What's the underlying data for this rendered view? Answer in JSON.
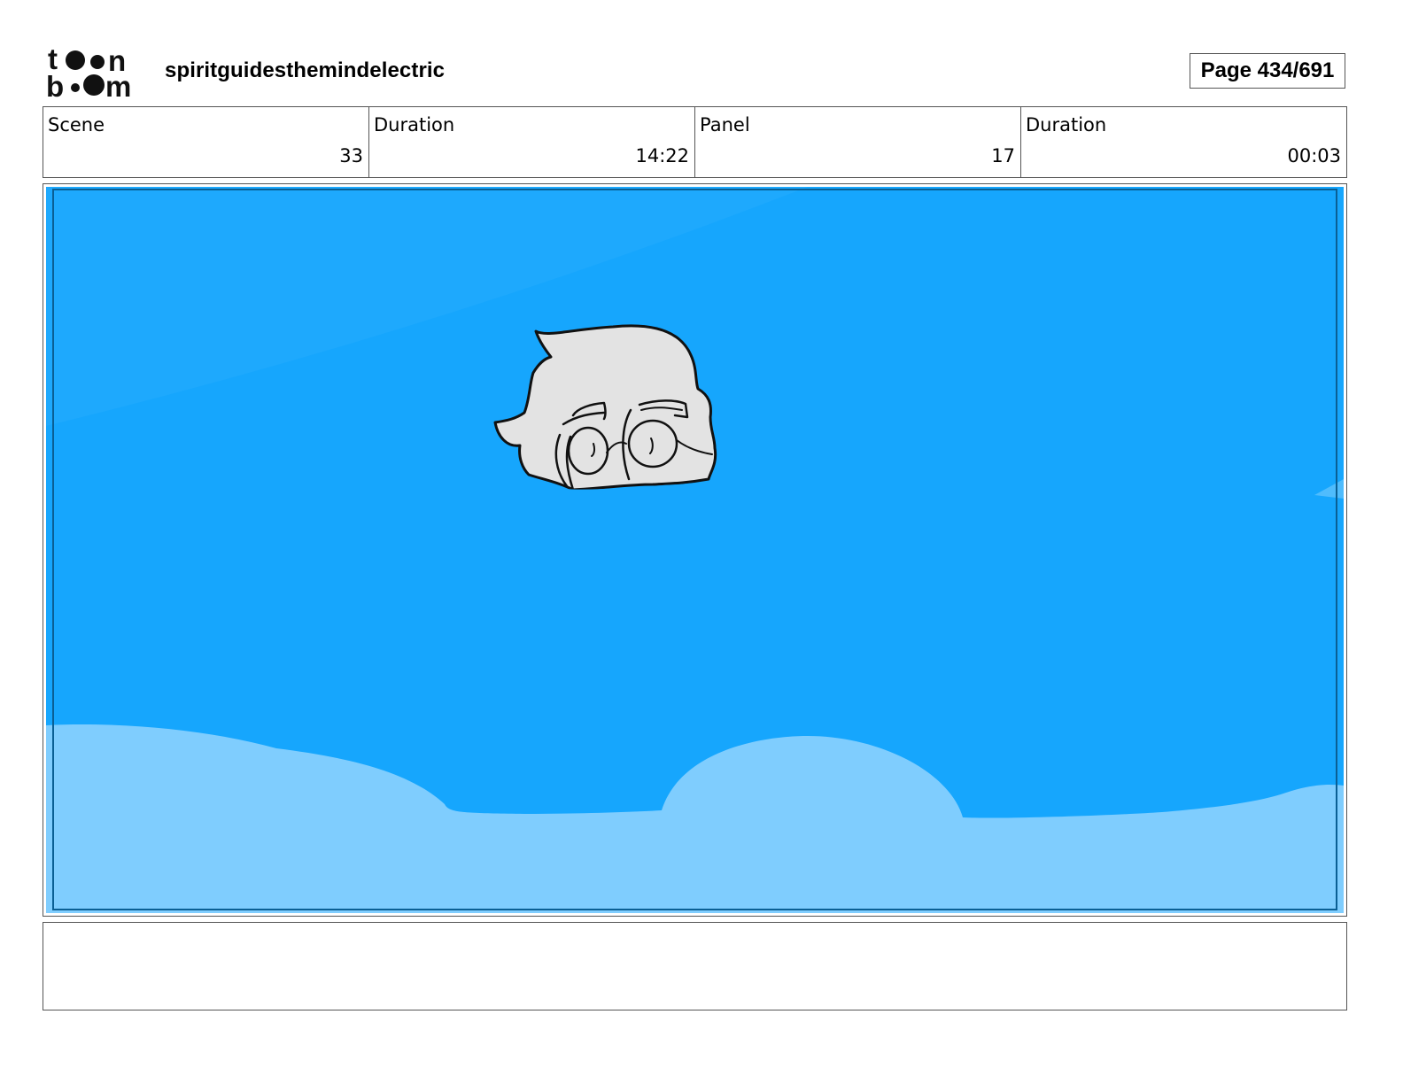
{
  "header": {
    "logo_icon": "toon-boom-logo",
    "project_title": "spiritguidesthemindelectric",
    "page_label": "Page 434/691"
  },
  "info": {
    "scene_label": "Scene",
    "scene_value": "33",
    "scene_duration_label": "Duration",
    "scene_duration_value": "14:22",
    "panel_label": "Panel",
    "panel_value": "17",
    "panel_duration_label": "Duration",
    "panel_duration_value": "00:03"
  },
  "panel": {
    "sky_color": "#16a6fd",
    "cloud_color": "#7fcdfe",
    "hair_color": "#e3e3e3"
  },
  "notes": {
    "text": ""
  }
}
